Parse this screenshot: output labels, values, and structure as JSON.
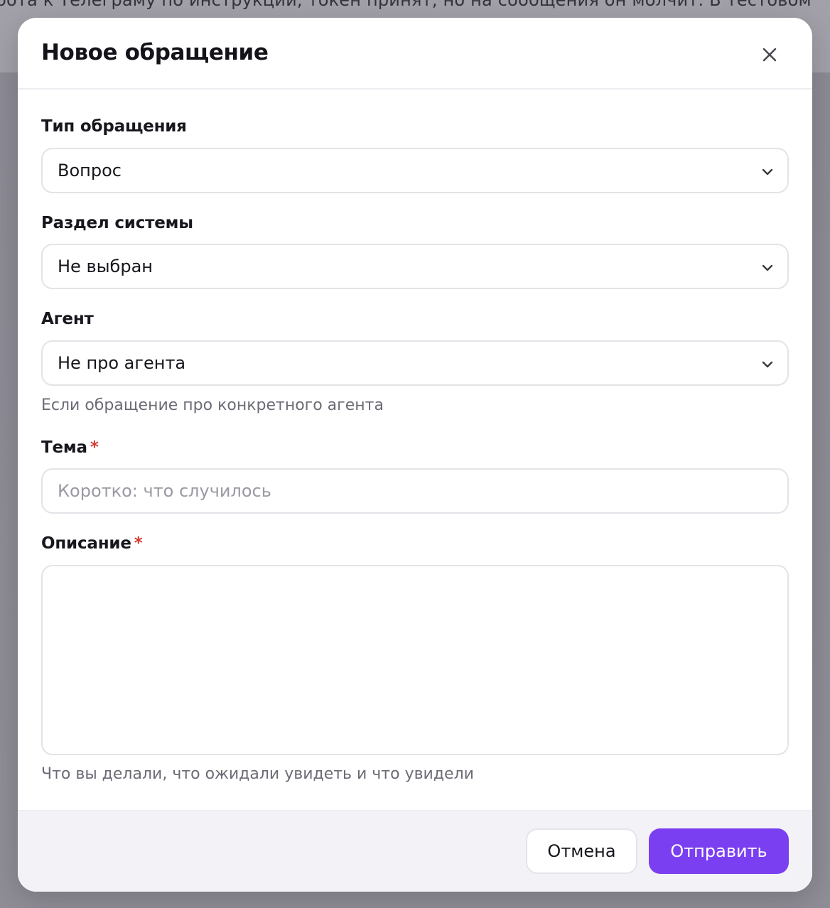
{
  "background": {
    "text": "бота к Телеграму по инструкции, токен принят, но на сообщения он молчит. В тестовом"
  },
  "modal": {
    "title": "Новое обращение",
    "close_icon": "close-icon"
  },
  "form": {
    "type": {
      "label": "Тип обращения",
      "value": "Вопрос"
    },
    "section": {
      "label": "Раздел системы",
      "value": "Не выбран"
    },
    "agent": {
      "label": "Агент",
      "value": "Не про агента",
      "hint": "Если обращение про конкретного агента"
    },
    "subject": {
      "label": "Тема",
      "required_mark": "*",
      "placeholder": "Коротко: что случилось",
      "value": ""
    },
    "description": {
      "label": "Описание",
      "required_mark": "*",
      "value": "",
      "hint": "Что вы делали, что ожидали увидеть и что увидели"
    }
  },
  "footer": {
    "cancel_label": "Отмена",
    "submit_label": "Отправить"
  },
  "colors": {
    "accent": "#7a3ff0",
    "required": "#d43a2f",
    "overlay": "#8e8c95"
  }
}
